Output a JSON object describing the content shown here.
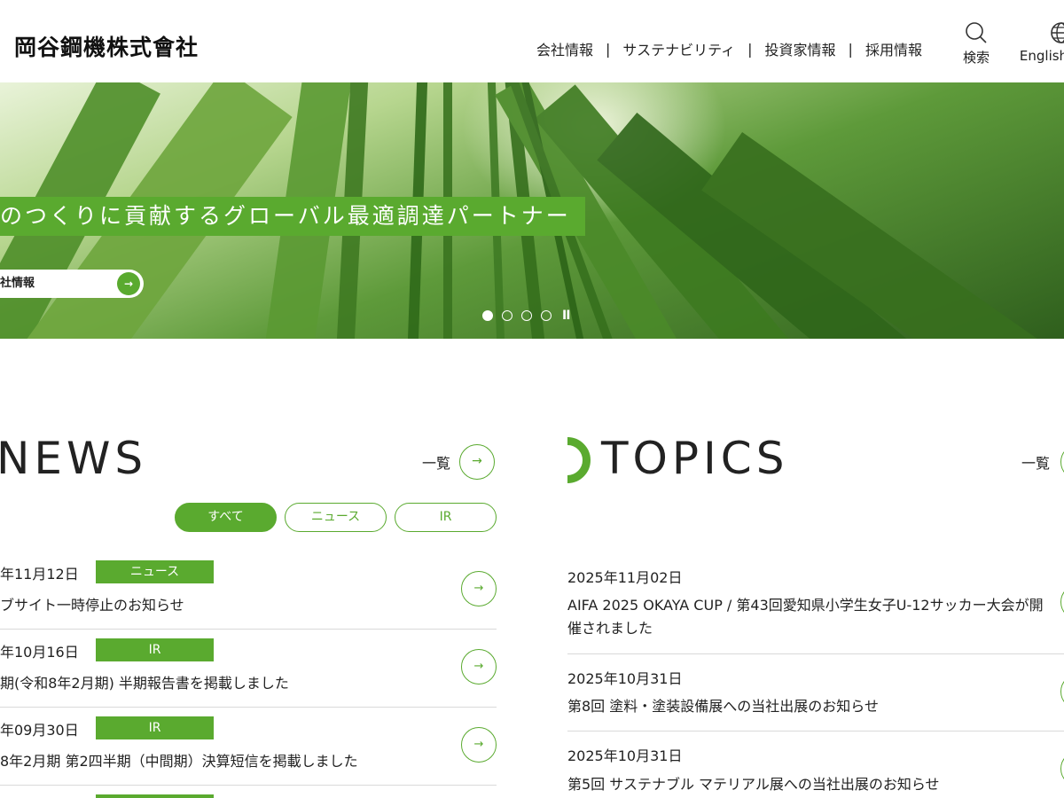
{
  "header": {
    "logo": "岡谷鋼機株式會社",
    "nav": [
      "会社情報",
      "サステナビリティ",
      "投資家情報",
      "採用情報"
    ],
    "search_label": "検索",
    "lang_label": "English"
  },
  "hero": {
    "catch": "のつくりに貢献するグローバル最適調達パートナー",
    "button_label": "社情報",
    "button_arrow": "→",
    "slides": 4,
    "active_slide": 1,
    "pause": "II"
  },
  "news": {
    "title": "NEWS",
    "more_label": "一覧",
    "more_arrow": "→",
    "filters": [
      "すべて",
      "ニュース",
      "IR"
    ],
    "items": [
      {
        "date": "年11月12日",
        "category": "ニュース",
        "title": "ブサイト一時停止のお知らせ",
        "arrow": "→"
      },
      {
        "date": "年10月16日",
        "category": "IR",
        "title": "期(令和8年2月期) 半期報告書を掲載しました",
        "arrow": "→"
      },
      {
        "date": "年09月30日",
        "category": "IR",
        "title": "8年2月期 第2四半期（中間期）決算短信を掲載しました",
        "arrow": "→"
      }
    ]
  },
  "topics": {
    "title": "TOPICS",
    "more_label": "一覧",
    "items": [
      {
        "date": "2025年11月02日",
        "title": "AIFA 2025 OKAYA CUP / 第43回愛知県小学生女子U-12サッカー大会が開催されました"
      },
      {
        "date": "2025年10月31日",
        "title": "第8回 塗料・塗装設備展への当社出展のお知らせ"
      },
      {
        "date": "2025年10月31日",
        "title": "第5回 サステナブル マテリアル展への当社出展のお知らせ"
      }
    ]
  },
  "colors": {
    "accent": "#5aaa2f",
    "divider": "#d9d9d9",
    "text": "#222222"
  },
  "icons": {
    "search": "search-icon",
    "globe": "globe-icon",
    "arrow": "arrow-right-icon"
  }
}
